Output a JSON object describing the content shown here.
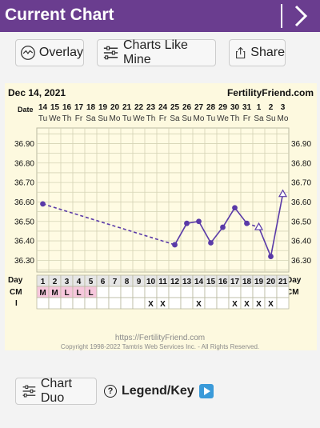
{
  "header": {
    "title": "Current Chart"
  },
  "toolbar": {
    "overlay_label": "Overlay",
    "charts_like_mine_label": "Charts Like Mine",
    "share_label": "Share"
  },
  "chart_meta": {
    "start_date": "Dec 14, 2021",
    "site": "FertilityFriend.com",
    "date_row_label": "Date",
    "day_row_label": "Day",
    "cm_row_label": "CM",
    "i_row_label": "I",
    "url": "https://FertilityFriend.com",
    "copyright": "Copyright 1998-2022 Tamtris Web Services Inc. - All Rights Reserved."
  },
  "chart_data": {
    "type": "line",
    "dates": [
      "14",
      "15",
      "16",
      "17",
      "18",
      "19",
      "20",
      "21",
      "22",
      "23",
      "24",
      "25",
      "26",
      "27",
      "28",
      "29",
      "30",
      "31",
      "1",
      "2",
      "3"
    ],
    "weekdays": [
      "Tu",
      "We",
      "Th",
      "Fr",
      "Sa",
      "Su",
      "Mo",
      "Tu",
      "We",
      "Th",
      "Fr",
      "Sa",
      "Su",
      "Mo",
      "Tu",
      "We",
      "Th",
      "Fr",
      "Sa",
      "Su",
      "Mo"
    ],
    "days": [
      1,
      2,
      3,
      4,
      5,
      6,
      7,
      8,
      9,
      10,
      11,
      12,
      13,
      14,
      15,
      16,
      17,
      18,
      19,
      20,
      21
    ],
    "temperatures": [
      36.59,
      null,
      null,
      null,
      null,
      null,
      null,
      null,
      null,
      null,
      null,
      36.38,
      36.49,
      36.5,
      36.39,
      36.47,
      36.57,
      36.49,
      36.47,
      36.32,
      36.64
    ],
    "open_markers": [
      19,
      21
    ],
    "dashed_segments": [
      [
        1,
        12
      ],
      [
        18,
        19
      ]
    ],
    "cm": [
      "M",
      "M",
      "L",
      "L",
      "L",
      "",
      "",
      "",
      "",
      "",
      "",
      "",
      "",
      "",
      "",
      "",
      "",
      "",
      "",
      "",
      ""
    ],
    "intercourse": [
      "",
      "",
      "",
      "",
      "",
      "",
      "",
      "",
      "",
      "X",
      "X",
      "",
      "",
      "X",
      "",
      "",
      "X",
      "X",
      "X",
      "X",
      ""
    ],
    "y_ticks": [
      36.9,
      36.8,
      36.7,
      36.6,
      36.5,
      36.4,
      36.3
    ],
    "ylim": [
      36.25,
      36.95
    ],
    "color": "#5a3aa8",
    "cm_color": "#f6c7dc",
    "grid": true
  },
  "bottom": {
    "chart_duo_label": "Chart Duo",
    "legend_label": "Legend/Key",
    "legend_marker": "?"
  }
}
